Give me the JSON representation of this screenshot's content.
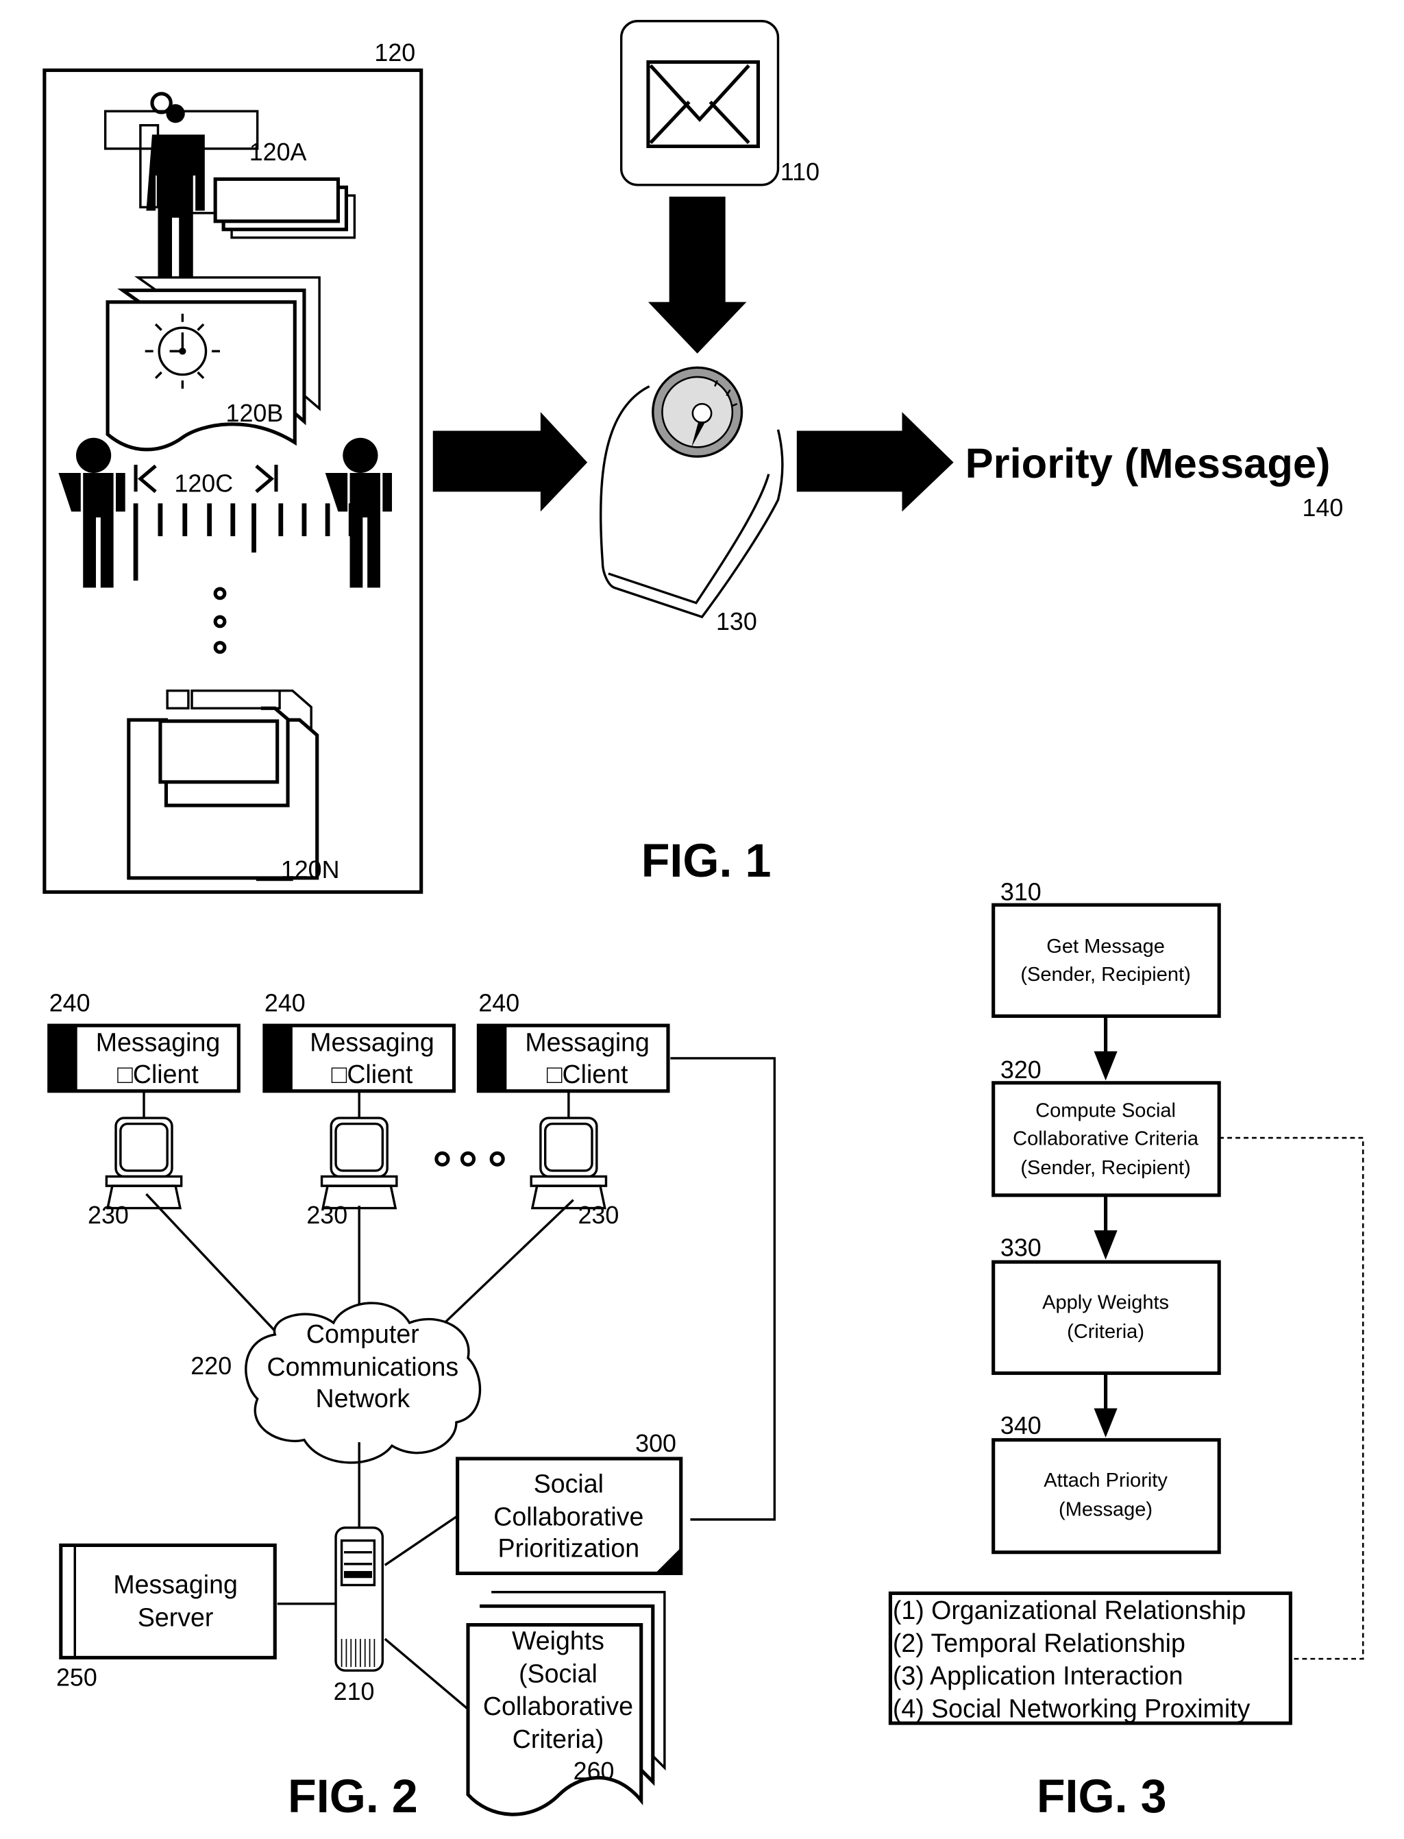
{
  "colors": {
    "ink": "#000000",
    "paper": "#ffffff",
    "dial_fill": "#bdbdbd"
  },
  "fig1": {
    "title": "FIG. 1",
    "message_ref": "110",
    "message_icon": "envelope-icon",
    "criteria_panel_ref": "120",
    "criteria": [
      {
        "ref": "120A",
        "icon": "organizational-person-icon"
      },
      {
        "ref": "120B",
        "icon": "temporal-clock-document-icon"
      },
      {
        "ref": "120C",
        "icon": "social-distance-people-icon"
      },
      {
        "ref": "120N",
        "icon": "application-floppy-icon"
      }
    ],
    "scale_ref": "130",
    "scale_icon": "weighing-scale-icon",
    "output_label": "Priority (Message)",
    "output_ref": "140"
  },
  "fig2": {
    "title": "FIG. 2",
    "clients": [
      {
        "ref": "240",
        "label_line1": "Messaging",
        "label_line2": "□Client",
        "computer_ref": "230"
      },
      {
        "ref": "240",
        "label_line1": "Messaging",
        "label_line2": "□Client",
        "computer_ref": "230"
      },
      {
        "ref": "240",
        "label_line1": "Messaging",
        "label_line2": "□Client",
        "computer_ref": "230"
      }
    ],
    "network": {
      "ref": "220",
      "lines": [
        "Computer",
        "Communications",
        "Network"
      ]
    },
    "server_ref": "210",
    "messaging_server": {
      "ref": "250",
      "lines": [
        "Messaging",
        "Server"
      ]
    },
    "prioritization": {
      "ref": "300",
      "lines": [
        "Social",
        "Collaborative",
        "Prioritization"
      ]
    },
    "weights": {
      "ref": "260",
      "lines": [
        "Weights",
        "(Social",
        "Collaborative",
        "Criteria)"
      ]
    }
  },
  "fig3": {
    "title": "FIG. 3",
    "steps": [
      {
        "ref": "310",
        "lines": [
          "Get Message",
          "(Sender, Recipient)"
        ]
      },
      {
        "ref": "320",
        "lines": [
          "Compute Social",
          "Collaborative Criteria",
          "(Sender, Recipient)"
        ]
      },
      {
        "ref": "330",
        "lines": [
          "Apply Weights",
          "(Criteria)"
        ]
      },
      {
        "ref": "340",
        "lines": [
          "Attach Priority",
          "(Message)"
        ]
      }
    ],
    "criteria_list": [
      "(1) Organizational Relationship",
      "(2) Temporal Relationship",
      "(3) Application Interaction",
      "(4) Social Networking Proximity"
    ]
  }
}
